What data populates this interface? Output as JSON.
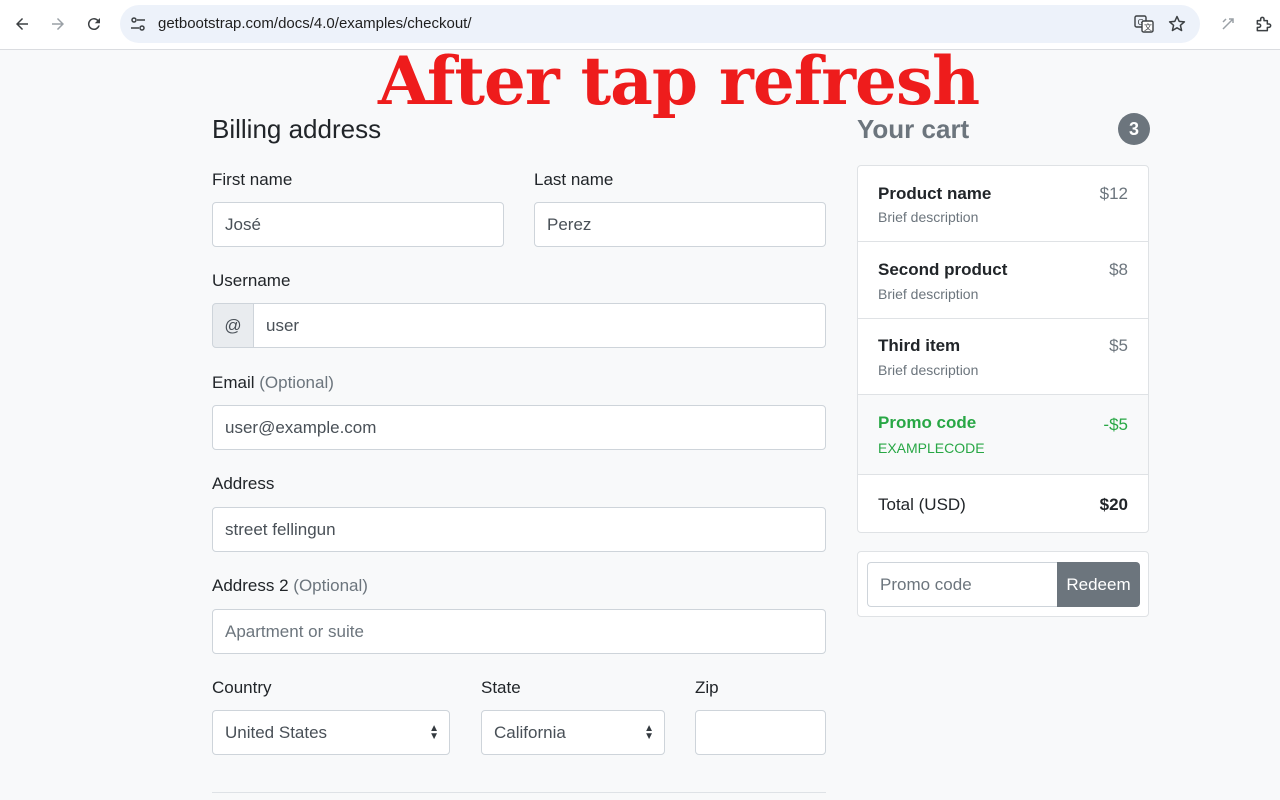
{
  "browser": {
    "url": "getbootstrap.com/docs/4.0/examples/checkout/",
    "back_icon": "arrow-left-icon",
    "forward_icon": "arrow-right-icon",
    "reload_icon": "reload-icon",
    "translate_icon": "translate-icon",
    "bookmark_icon": "star-icon"
  },
  "overlay": {
    "text": "After tap refresh",
    "color": "#ee1c1c"
  },
  "billing": {
    "heading": "Billing address",
    "first_name": {
      "label": "First name",
      "value": "José"
    },
    "last_name": {
      "label": "Last name",
      "value": "Perez"
    },
    "username": {
      "label": "Username",
      "prefix": "@",
      "value": "user"
    },
    "email": {
      "label": "Email",
      "optional": "(Optional)",
      "value": "user@example.com"
    },
    "address": {
      "label": "Address",
      "value": "street fellingun"
    },
    "address2": {
      "label": "Address 2",
      "optional": "(Optional)",
      "placeholder": "Apartment or suite"
    },
    "country": {
      "label": "Country",
      "value": "United States"
    },
    "state": {
      "label": "State",
      "value": "California"
    },
    "zip": {
      "label": "Zip",
      "value": ""
    }
  },
  "cart": {
    "heading": "Your cart",
    "count": "3",
    "items": [
      {
        "name": "Product name",
        "desc": "Brief description",
        "price": "$12"
      },
      {
        "name": "Second product",
        "desc": "Brief description",
        "price": "$8"
      },
      {
        "name": "Third item",
        "desc": "Brief description",
        "price": "$5"
      }
    ],
    "promo": {
      "name": "Promo code",
      "code": "EXAMPLECODE",
      "amount": "-$5"
    },
    "total": {
      "label": "Total (USD)",
      "value": "$20"
    },
    "promo_form": {
      "placeholder": "Promo code",
      "button": "Redeem"
    }
  },
  "colors": {
    "accent_gray": "#6c757d",
    "success": "#28a745",
    "page_bg": "#f8f9fa"
  }
}
